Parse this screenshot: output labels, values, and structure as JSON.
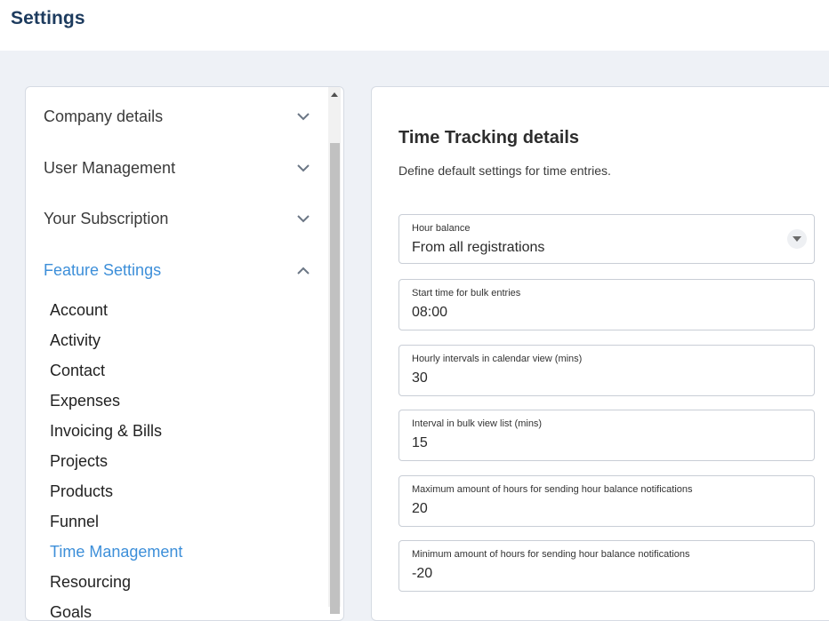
{
  "header": {
    "title": "Settings"
  },
  "sidebar": {
    "sections": [
      {
        "label": "Company details",
        "expanded": false
      },
      {
        "label": "User Management",
        "expanded": false
      },
      {
        "label": "Your Subscription",
        "expanded": false
      },
      {
        "label": "Feature Settings",
        "expanded": true
      }
    ],
    "sub_items": [
      {
        "label": "Account"
      },
      {
        "label": "Activity"
      },
      {
        "label": "Contact"
      },
      {
        "label": "Expenses"
      },
      {
        "label": "Invoicing & Bills"
      },
      {
        "label": "Projects"
      },
      {
        "label": "Products"
      },
      {
        "label": "Funnel"
      },
      {
        "label": "Time Management",
        "active": true
      },
      {
        "label": "Resourcing"
      },
      {
        "label": "Goals"
      }
    ]
  },
  "main": {
    "title": "Time Tracking details",
    "description": "Define default settings for time entries.",
    "fields": [
      {
        "label": "Hour balance",
        "value": "From all registrations",
        "type": "select"
      },
      {
        "label": "Start time for bulk entries",
        "value": "08:00",
        "type": "text"
      },
      {
        "label": "Hourly intervals in calendar view (mins)",
        "value": "30",
        "type": "text"
      },
      {
        "label": "Interval in bulk view list (mins)",
        "value": "15",
        "type": "text"
      },
      {
        "label": "Maximum amount of hours for sending hour balance notifications",
        "value": "20",
        "type": "text"
      },
      {
        "label": "Minimum amount of hours for sending hour balance notifications",
        "value": "-20",
        "type": "text"
      }
    ]
  },
  "colors": {
    "accent": "#3d8fd9",
    "title": "#1d3b5e",
    "background": "#eef1f6"
  },
  "icons": {
    "chevron_down": "chevron-down-icon",
    "chevron_up": "chevron-up-icon",
    "caret_down": "caret-down-icon",
    "scroll_up": "scroll-up-arrow-icon"
  }
}
